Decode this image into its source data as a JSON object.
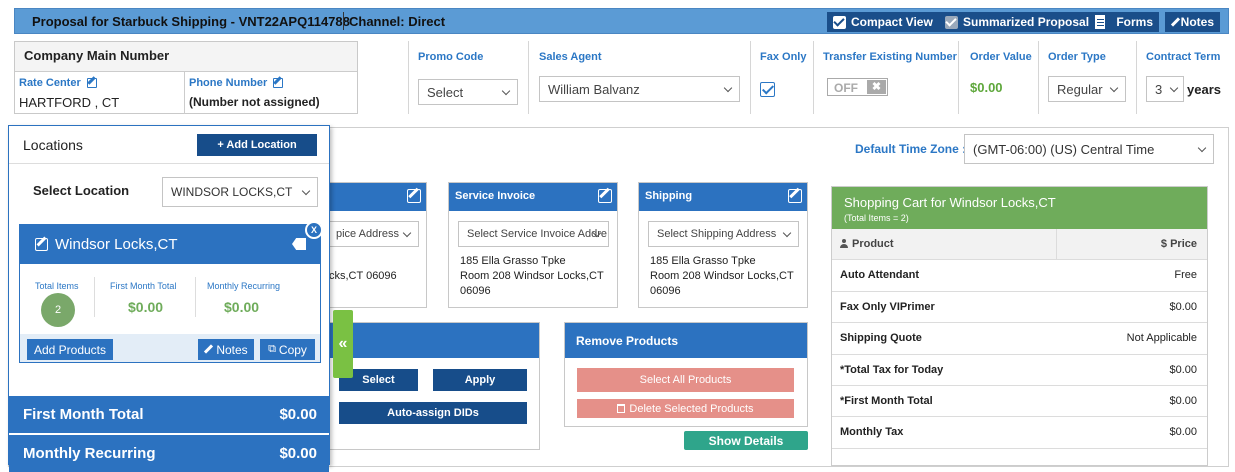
{
  "header": {
    "title": "Proposal for Starbuck Shipping - VNT22APQ114788",
    "channel": "Channel: Direct",
    "compact_view": "Compact View",
    "summarized_proposal": "Summarized Proposal",
    "forms": "Forms",
    "notes": "Notes"
  },
  "company": {
    "title": "Company Main Number",
    "rate_center_label": "Rate Center",
    "rate_center_value": "HARTFORD , CT",
    "phone_label": "Phone Number",
    "phone_value": "(Number not assigned)"
  },
  "fields": {
    "promo_code_label": "Promo Code",
    "promo_code_value": "Select",
    "sales_agent_label": "Sales Agent",
    "sales_agent_value": "William Balvanz",
    "fax_only_label": "Fax Only",
    "fax_only_checked": true,
    "transfer_label": "Transfer Existing Number",
    "transfer_value": "OFF",
    "transfer_x": "✖",
    "order_value_label": "Order Value",
    "order_value": "$0.00",
    "order_type_label": "Order Type",
    "order_type_value": "Regular",
    "contract_term_label": "Contract Term",
    "contract_term_value": "3",
    "contract_term_unit": "years"
  },
  "timezone": {
    "label": "Default Time Zone :",
    "value": "(GMT-06:00) (US) Central Time"
  },
  "addresses": {
    "first": {
      "select": "pice Address",
      "line1": "cks,CT 06096"
    },
    "service": {
      "title": "Service Invoice",
      "select": "Select Service Invoice Addre",
      "line1": "185 Ella Grasso Tpke",
      "line2": "Room 208 Windsor Locks,CT",
      "line3": "06096"
    },
    "shipping": {
      "title": "Shipping",
      "select": "Select Shipping Address",
      "line1": "185 Ella Grasso Tpke",
      "line2": "Room 208 Windsor Locks,CT",
      "line3": "06096"
    }
  },
  "actions": {
    "select": "Select",
    "apply": "Apply",
    "auto_assign": "Auto-assign DIDs"
  },
  "remove_products": {
    "title": "Remove Products",
    "select_all": "Select All Products",
    "delete_selected": "Delete Selected Products",
    "show_details": "Show Details"
  },
  "cart": {
    "title": "Shopping Cart for Windsor Locks,CT",
    "subtitle": "(Total Items = 2)",
    "col_product": "Product",
    "col_price": "$ Price",
    "rows": [
      {
        "product": "Auto Attendant",
        "price": "Free"
      },
      {
        "product": "Fax Only VIPrimer",
        "price": "$0.00"
      },
      {
        "product": "Shipping Quote",
        "price": "Not Applicable"
      },
      {
        "product": "*Total Tax for Today",
        "price": "$0.00"
      },
      {
        "product": "*First Month Total",
        "price": "$0.00"
      },
      {
        "product": "Monthly Tax",
        "price": "$0.00"
      }
    ]
  },
  "locations": {
    "title": "Locations",
    "add_button": "+ Add Location",
    "select_label": "Select Location",
    "select_value": "WINDSOR LOCKS,CT",
    "card": {
      "name": "Windsor Locks,CT",
      "close": "X",
      "total_items_label": "Total Items",
      "total_items_value": "2",
      "first_month_label": "First Month Total",
      "first_month_value": "$0.00",
      "monthly_label": "Monthly Recurring",
      "monthly_value": "$0.00",
      "add_products": "Add Products",
      "notes": "Notes",
      "copy": "Copy"
    },
    "first_month_total_label": "First Month Total",
    "first_month_total_value": "$0.00",
    "monthly_recurring_label": "Monthly Recurring",
    "monthly_recurring_value": "$0.00",
    "collapse": "«"
  },
  "colors": {
    "header_bg": "#5b9bd5",
    "primary_blue": "#2c72c0",
    "dark_blue": "#174d8a",
    "green": "#6fac5b",
    "teal": "#2fa58b",
    "salmon": "#e59089"
  }
}
